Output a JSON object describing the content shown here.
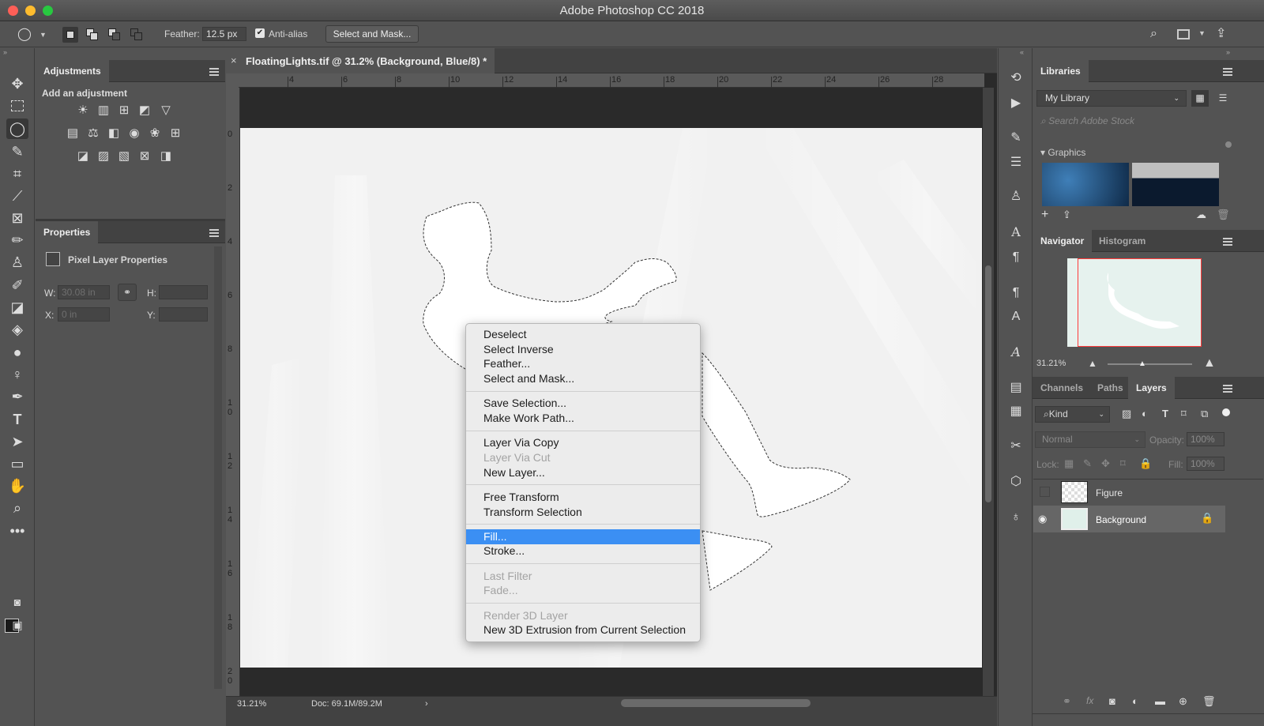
{
  "window": {
    "title": "Adobe Photoshop CC 2018"
  },
  "options": {
    "feather_label": "Feather:",
    "feather_value": "12.5 px",
    "antialias_label": "Anti-alias",
    "select_mask_label": "Select and Mask..."
  },
  "adjustments": {
    "tab": "Adjustments",
    "heading": "Add an adjustment"
  },
  "properties": {
    "tab": "Properties",
    "title": "Pixel Layer Properties",
    "w_label": "W:",
    "w_value": "30.08 in",
    "h_label": "H:",
    "x_label": "X:",
    "x_value": "0 in",
    "y_label": "Y:"
  },
  "document": {
    "tab_title": "FloatingLights.tif @ 31.2% (Background, Blue/8) *",
    "zoom": "31.21%",
    "doc_size": "Doc: 69.1M/89.2M"
  },
  "rulers": {
    "top": [
      "4",
      "6",
      "8",
      "10",
      "12",
      "14",
      "16",
      "18",
      "20",
      "22",
      "24",
      "26",
      "28"
    ],
    "left": [
      "0",
      "2",
      "4",
      "6",
      "8",
      "1\n0",
      "1\n2",
      "1\n4",
      "1\n6",
      "1\n8",
      "2\n0"
    ]
  },
  "context_menu": {
    "items": [
      {
        "label": "Deselect",
        "enabled": true
      },
      {
        "label": "Select Inverse",
        "enabled": true
      },
      {
        "label": "Feather...",
        "enabled": true
      },
      {
        "label": "Select and Mask...",
        "enabled": true
      },
      {
        "label": "Save Selection...",
        "enabled": true
      },
      {
        "label": "Make Work Path...",
        "enabled": true
      },
      {
        "label": "Layer Via Copy",
        "enabled": true
      },
      {
        "label": "Layer Via Cut",
        "enabled": false
      },
      {
        "label": "New Layer...",
        "enabled": true
      },
      {
        "label": "Free Transform",
        "enabled": true
      },
      {
        "label": "Transform Selection",
        "enabled": true
      },
      {
        "label": "Fill...",
        "enabled": true,
        "highlighted": true
      },
      {
        "label": "Stroke...",
        "enabled": true
      },
      {
        "label": "Last Filter",
        "enabled": false
      },
      {
        "label": "Fade...",
        "enabled": false
      },
      {
        "label": "Render 3D Layer",
        "enabled": false
      },
      {
        "label": "New 3D Extrusion from Current Selection",
        "enabled": true
      }
    ]
  },
  "libraries": {
    "tab": "Libraries",
    "library": "My Library",
    "search_placeholder": "Search Adobe Stock",
    "section": "Graphics"
  },
  "navigator": {
    "tab": "Navigator",
    "tab2": "Histogram",
    "zoom": "31.21%"
  },
  "layers": {
    "tabs": [
      "Channels",
      "Paths",
      "Layers"
    ],
    "kind": "Kind",
    "blend": "Normal",
    "opacity_label": "Opacity:",
    "opacity_value": "100%",
    "lock_label": "Lock:",
    "fill_label": "Fill:",
    "fill_value": "100%",
    "items": [
      {
        "name": "Figure",
        "visible": false,
        "locked": false
      },
      {
        "name": "Background",
        "visible": true,
        "locked": true
      }
    ]
  },
  "colors": {
    "accent": "#3b8ff3",
    "panel": "#535353",
    "tab_bg": "#424242"
  }
}
